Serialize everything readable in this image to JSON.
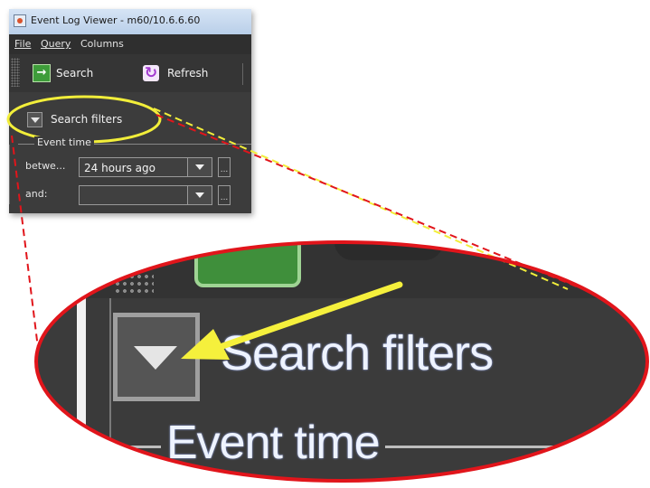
{
  "window": {
    "title": "Event Log Viewer - m60/10.6.6.60",
    "menu": {
      "file": "File",
      "query": "Query",
      "columns": "Columns"
    },
    "toolbar": {
      "search_label": "Search",
      "refresh_label": "Refresh"
    },
    "filters": {
      "toggle_label": "Search filters",
      "group_label": "Event time",
      "between_label": "betwe...",
      "between_value": "24 hours ago",
      "and_label": "and:",
      "and_value": "",
      "browse_label": "..."
    }
  },
  "callout": {
    "toggle_label": "Search filters",
    "group_label": "Event time"
  },
  "colors": {
    "highlight": "#f2ee3a",
    "callout_border": "#e1151b",
    "arrow": "#f5f03c",
    "panel_bg": "#3b3b3b"
  },
  "icons": [
    "app-icon",
    "search-icon",
    "refresh-icon",
    "chevron-down-icon",
    "callout-arrow-icon"
  ]
}
